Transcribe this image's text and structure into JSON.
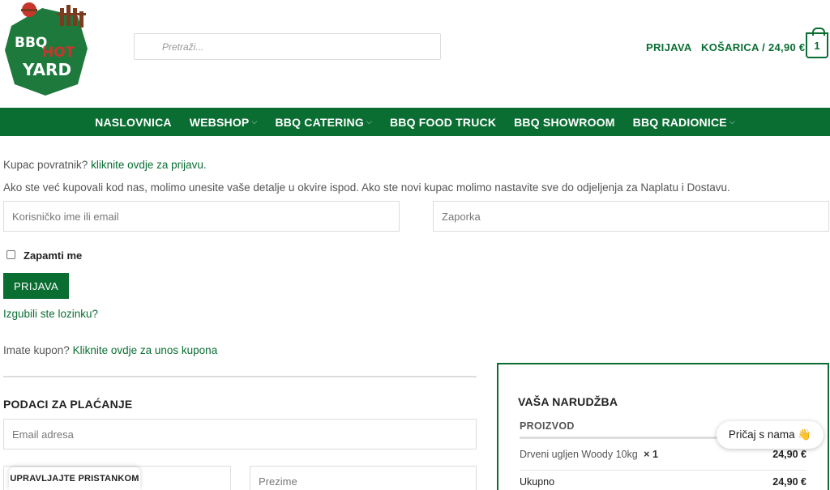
{
  "brand": {
    "logo_text_1": "BBQ",
    "logo_text_2": "HOT",
    "logo_text_3": "YARD",
    "accent": "#0a6e33",
    "logo_green": "#1e7a3c",
    "logo_red": "#c8352c"
  },
  "header": {
    "search_placeholder": "Pretraži...",
    "login_label": "PRIJAVA",
    "cart_label": "KOŠARICA / 24,90 €",
    "cart_count": "1"
  },
  "nav": {
    "items": [
      {
        "label": "NASLOVNICA",
        "dropdown": false
      },
      {
        "label": "WEBSHOP",
        "dropdown": true
      },
      {
        "label": "BBQ CATERING",
        "dropdown": true
      },
      {
        "label": "BBQ FOOD TRUCK",
        "dropdown": false
      },
      {
        "label": "BBQ SHOWROOM",
        "dropdown": false
      },
      {
        "label": "BBQ RADIONICE",
        "dropdown": true
      }
    ]
  },
  "login": {
    "returning_text": "Kupac povratnik?",
    "returning_link": "kliknite ovdje za prijavu.",
    "instructions": "Ako ste već kupovali kod nas, molimo unesite vaše detalje u okvire ispod. Ako ste novi kupac molimo nastavite sve do odjeljenja za Naplatu i Dostavu.",
    "username_placeholder": "Korisničko ime ili email",
    "password_placeholder": "Zaporka",
    "remember_label": "Zapamti me",
    "submit_label": "PRIJAVA",
    "lost_password": "Izgubili ste lozinku?"
  },
  "coupon": {
    "text": "Imate kupon?",
    "link": "Kliknite ovdje za unos kupona"
  },
  "billing": {
    "title": "PODACI ZA PLAĆANJE",
    "email_placeholder": "Email adresa",
    "lastname_placeholder": "Prezime"
  },
  "order": {
    "title": "VAŠA NARUDŽBA",
    "column_product": "PROIZVOD",
    "item_name": "Drveni ugljen Woody 10kg",
    "item_qty": "× 1",
    "item_price": "24,90 €",
    "total_label": "Ukupno",
    "total_price": "24,90 €"
  },
  "chat": {
    "label": "Pričaj s nama 👋"
  },
  "consent": {
    "label": "UPRAVLJAJTE PRISTANKOM"
  }
}
